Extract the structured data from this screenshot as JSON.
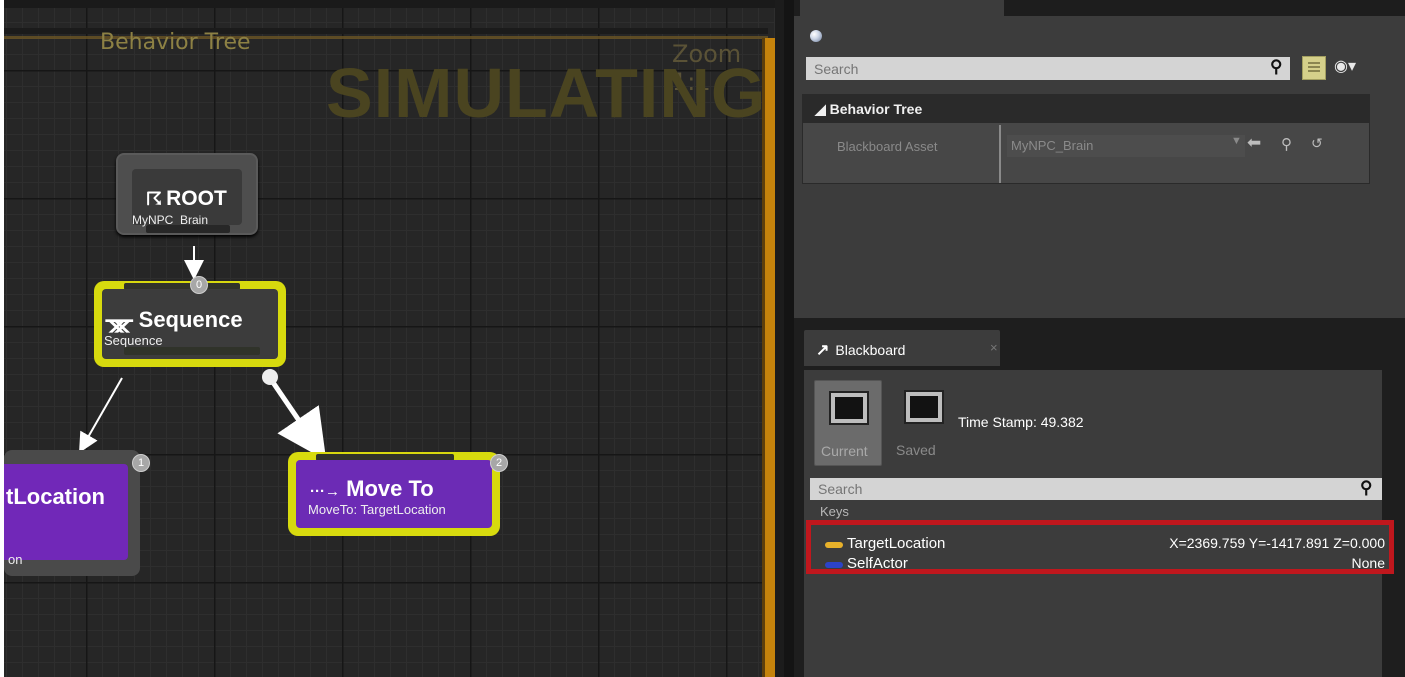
{
  "graph": {
    "title": "Behavior Tree",
    "zoom": "Zoom 1:1",
    "status": "SIMULATING",
    "nodes": {
      "root": {
        "icon": "☈",
        "title": "ROOT",
        "subtitle": "MyNPC_Brain"
      },
      "sequence": {
        "icon": "ᚘ",
        "title": "Sequence",
        "subtitle": "Sequence",
        "index": "0"
      },
      "target": {
        "title": "tLocation",
        "subtitle": "on",
        "index": "1"
      },
      "move": {
        "icon": "···→",
        "title": "Move To",
        "subtitle": "MoveTo: TargetLocation",
        "index": "2"
      }
    },
    "colors": {
      "task": "#6c2bb5",
      "active": "#d7da0e",
      "frame": "#c5830c"
    }
  },
  "details": {
    "search_placeholder": "Search",
    "category": "Behavior Tree",
    "property_label": "Blackboard Asset",
    "property_value": "MyNPC_Brain"
  },
  "blackboard": {
    "tab_label": "Blackboard",
    "tab_close": "×",
    "current_label": "Current",
    "saved_label": "Saved",
    "timestamp": "Time Stamp: 49.382",
    "search_placeholder": "Search",
    "keys_label": "Keys",
    "keys": [
      {
        "name": "TargetLocation",
        "value": "X=2369.759 Y=-1417.891 Z=0.000",
        "color": "#e8b12a"
      },
      {
        "name": "SelfActor",
        "value": "None",
        "color": "#2c43c9"
      }
    ],
    "highlight_color": "#c0171d"
  }
}
